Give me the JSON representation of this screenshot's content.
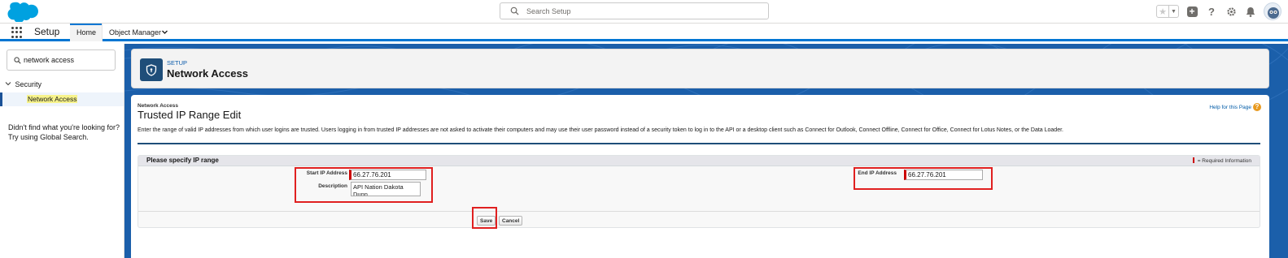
{
  "header": {
    "search_placeholder": "Search Setup",
    "icons": [
      "salesforce-cloud-logo",
      "search-icon",
      "star-icon",
      "chevron-down-icon",
      "plus-icon",
      "help-icon",
      "gear-icon",
      "bell-icon",
      "avatar"
    ]
  },
  "context_bar": {
    "app_name": "Setup",
    "tabs": [
      {
        "label": "Home",
        "active": true
      },
      {
        "label": "Object Manager",
        "active": false
      }
    ]
  },
  "sidebar": {
    "quick_find_value": "network access",
    "section": "Security",
    "items": [
      {
        "label": "Network Access",
        "selected": true
      }
    ],
    "not_found_line1": "Didn't find what you're looking for?",
    "not_found_line2": "Try using Global Search."
  },
  "setup_header": {
    "eyebrow": "SETUP",
    "title": "Network Access"
  },
  "page": {
    "breadcrumb": "Network Access",
    "title": "Trusted IP Range Edit",
    "help_link": "Help for this Page",
    "intro": "Enter the range of valid IP addresses from which user logins are trusted. Users logging in from trusted IP addresses are not asked to activate their computers and may use their user password instead of a security token to log in to the API or a desktop client such as Connect for Outlook, Connect Offline, Connect for Office, Connect for Lotus Notes, or the Data Loader.",
    "block_title": "Please specify IP range",
    "required_info": "= Required Information",
    "fields": {
      "start_label": "Start IP Address",
      "start_value": "66.27.76.201",
      "description_label": "Description",
      "description_value": "API Nation Dakota Dunn",
      "end_label": "End IP Address",
      "end_value": "66.27.76.201"
    },
    "buttons": {
      "save": "Save",
      "cancel": "Cancel"
    }
  },
  "colors": {
    "brand_blue": "#0176d3",
    "banner_blue": "#1b5faa",
    "highlight_red": "#e02020",
    "required_red": "#cc0000"
  }
}
